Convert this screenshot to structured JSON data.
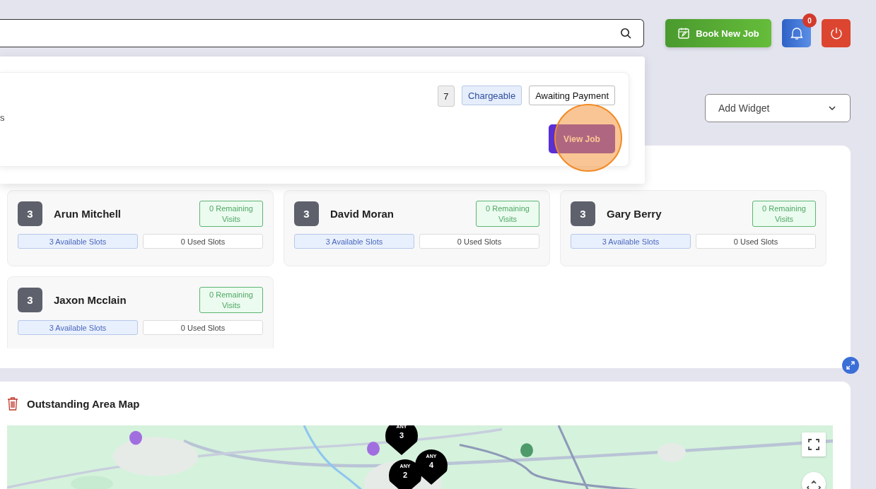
{
  "header_buttons": [
    {
      "kind": "book",
      "label": "Book New Job"
    },
    {
      "kind": "notifications",
      "badge": "0"
    },
    {
      "kind": "power"
    }
  ],
  "add_widget": {
    "label": "Add Widget"
  },
  "job_popup": {
    "description_fragment": "s",
    "count": "7",
    "tags": [
      {
        "kind": "type",
        "label": "Chargeable"
      },
      {
        "kind": "status",
        "label": "Awaiting Payment"
      }
    ],
    "action": "View Job",
    "spotlight": true
  },
  "technicians": [
    {
      "initial": "3",
      "name": "Arun Mitchell",
      "remaining": "0 Remaining Visits",
      "available": "3 Available Slots",
      "used": "0 Used Slots"
    },
    {
      "initial": "3",
      "name": "David Moran",
      "remaining": "0 Remaining Visits",
      "available": "3 Available Slots",
      "used": "0 Used Slots"
    },
    {
      "initial": "3",
      "name": "Gary Berry",
      "remaining": "0 Remaining Visits",
      "available": "3 Available Slots",
      "used": "0 Used Slots"
    },
    {
      "initial": "3",
      "name": "Jaxon Mcclain",
      "remaining": "0 Remaining Visits",
      "available": "3 Available Slots",
      "used": "0 Used Slots"
    }
  ],
  "map_widget": {
    "title": "Outstanding Area Map",
    "markers": [
      {
        "label": "ANY",
        "count": "3"
      },
      {
        "label": "ANY",
        "count": "4"
      },
      {
        "label": "ANY",
        "count": "2"
      }
    ]
  }
}
